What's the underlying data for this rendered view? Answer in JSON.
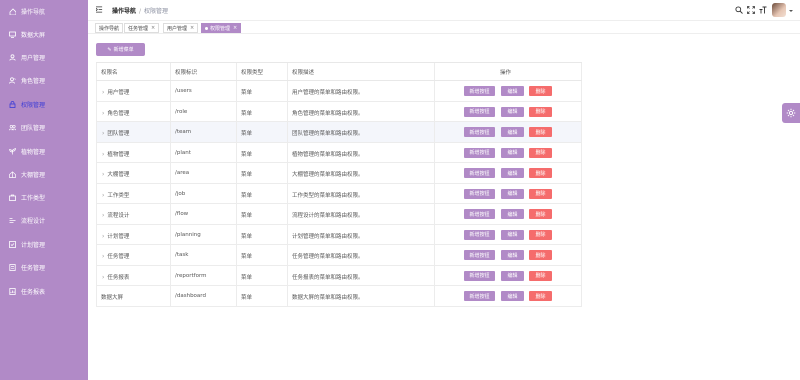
{
  "sidebar": {
    "items": [
      {
        "label": "操作导航",
        "icon": "home-icon"
      },
      {
        "label": "数据大屏",
        "icon": "monitor-icon"
      },
      {
        "label": "用户管理",
        "icon": "user-icon"
      },
      {
        "label": "角色管理",
        "icon": "user-role-icon"
      },
      {
        "label": "权限管理",
        "icon": "lock-icon",
        "active": true
      },
      {
        "label": "团队管理",
        "icon": "team-icon"
      },
      {
        "label": "植物管理",
        "icon": "plant-icon"
      },
      {
        "label": "大棚管理",
        "icon": "greenhouse-icon"
      },
      {
        "label": "工作类型",
        "icon": "briefcase-icon"
      },
      {
        "label": "流程设计",
        "icon": "flow-icon"
      },
      {
        "label": "计划管理",
        "icon": "plan-icon"
      },
      {
        "label": "任务管理",
        "icon": "task-icon"
      },
      {
        "label": "任务报表",
        "icon": "report-icon"
      }
    ]
  },
  "header": {
    "breadcrumb": [
      "操作导航",
      "权限管理"
    ]
  },
  "tags": [
    {
      "label": "操作导航",
      "closable": false
    },
    {
      "label": "任务管理",
      "closable": true
    },
    {
      "label": "用户管理",
      "closable": true
    },
    {
      "label": "权限管理",
      "closable": true,
      "active": true
    }
  ],
  "toolbar": {
    "add_label": "新增菜单"
  },
  "table": {
    "headers": [
      "权限名",
      "权限标识",
      "权限类型",
      "权限描述",
      "操作"
    ],
    "actions": {
      "add_button": "新增按钮",
      "edit": "编辑",
      "delete": "删除"
    },
    "rows": [
      {
        "name": "用户管理",
        "key": "/users",
        "type": "菜单",
        "desc": "用户管理的菜单和路由权限。",
        "expandable": true
      },
      {
        "name": "角色管理",
        "key": "/role",
        "type": "菜单",
        "desc": "角色管理的菜单和路由权限。",
        "expandable": true
      },
      {
        "name": "团队管理",
        "key": "/team",
        "type": "菜单",
        "desc": "团队管理的菜单和路由权限。",
        "expandable": true,
        "highlight": true
      },
      {
        "name": "植物管理",
        "key": "/plant",
        "type": "菜单",
        "desc": "植物管理的菜单和路由权限。",
        "expandable": true
      },
      {
        "name": "大棚管理",
        "key": "/area",
        "type": "菜单",
        "desc": "大棚管理的菜单和路由权限。",
        "expandable": true
      },
      {
        "name": "工作类型",
        "key": "/job",
        "type": "菜单",
        "desc": "工作类型的菜单和路由权限。",
        "expandable": true
      },
      {
        "name": "流程设计",
        "key": "/flow",
        "type": "菜单",
        "desc": "流程设计的菜单和路由权限。",
        "expandable": true
      },
      {
        "name": "计划管理",
        "key": "/planning",
        "type": "菜单",
        "desc": "计划管理的菜单和路由权限。",
        "expandable": true
      },
      {
        "name": "任务管理",
        "key": "/task",
        "type": "菜单",
        "desc": "任务管理的菜单和路由权限。",
        "expandable": true
      },
      {
        "name": "任务报表",
        "key": "/reportform",
        "type": "菜单",
        "desc": "任务报表的菜单和路由权限。",
        "expandable": true
      },
      {
        "name": "数据大屏",
        "key": "/dashboard",
        "type": "菜单",
        "desc": "数据大屏的菜单和路由权限。",
        "expandable": false
      }
    ]
  },
  "colors": {
    "accent": "#b18ac7",
    "danger": "#f56c6c",
    "active_text": "#3b3bd6"
  }
}
